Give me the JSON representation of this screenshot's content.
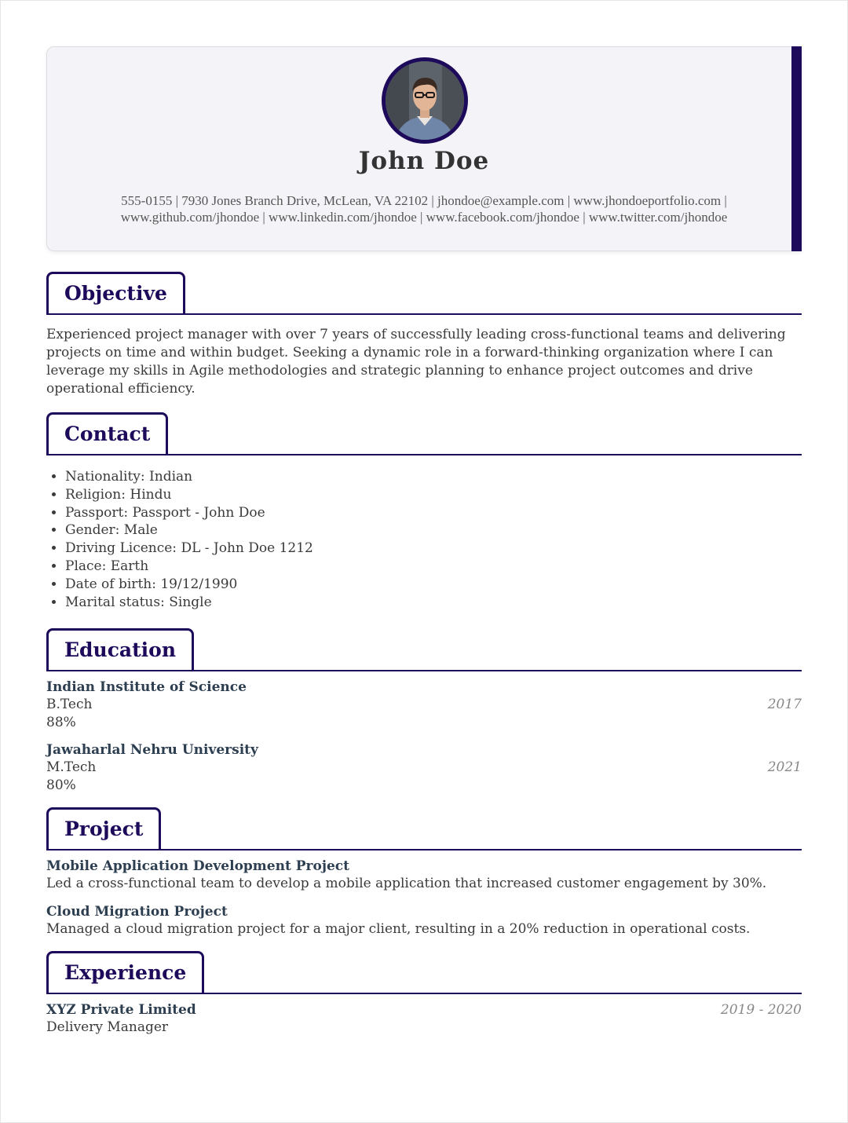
{
  "header": {
    "name": "John Doe",
    "contact_line_1": "555-0155 | 7930 Jones Branch Drive, McLean, VA 22102 | jhondoe@example.com | www.jhondoeportfolio.com |",
    "contact_line_2": "www.github.com/jhondoe | www.linkedin.com/jhondoe | www.facebook.com/jhondoe | www.twitter.com/jhondoe",
    "accent_color": "#1e0a5a"
  },
  "objective": {
    "heading": "Objective",
    "text": "Experienced project manager with over 7 years of successfully leading cross-functional teams and delivering projects on time and within budget. Seeking a dynamic role in a forward-thinking organization where I can leverage my skills in Agile methodologies and strategic planning to enhance project outcomes and drive operational efficiency."
  },
  "contact": {
    "heading": "Contact",
    "items": [
      "Nationality: Indian",
      "Religion: Hindu",
      "Passport: Passport - John Doe",
      "Gender: Male",
      "Driving Licence: DL - John Doe 1212",
      "Place: Earth",
      "Date of birth: 19/12/1990",
      "Marital status: Single"
    ]
  },
  "education": {
    "heading": "Education",
    "entries": [
      {
        "institution": "Indian Institute of Science",
        "degree": "B.Tech",
        "score": "88%",
        "year": "2017"
      },
      {
        "institution": "Jawaharlal Nehru University",
        "degree": "M.Tech",
        "score": "80%",
        "year": "2021"
      }
    ]
  },
  "project": {
    "heading": "Project",
    "entries": [
      {
        "title": "Mobile Application Development Project",
        "description": "Led a cross-functional team to develop a mobile application that increased customer engagement by 30%."
      },
      {
        "title": "Cloud Migration Project",
        "description": "Managed a cloud migration project for a major client, resulting in a 20% reduction in operational costs."
      }
    ]
  },
  "experience": {
    "heading": "Experience",
    "entries": [
      {
        "company": "XYZ Private Limited",
        "role": "Delivery Manager",
        "period": "2019 - 2020"
      }
    ]
  }
}
